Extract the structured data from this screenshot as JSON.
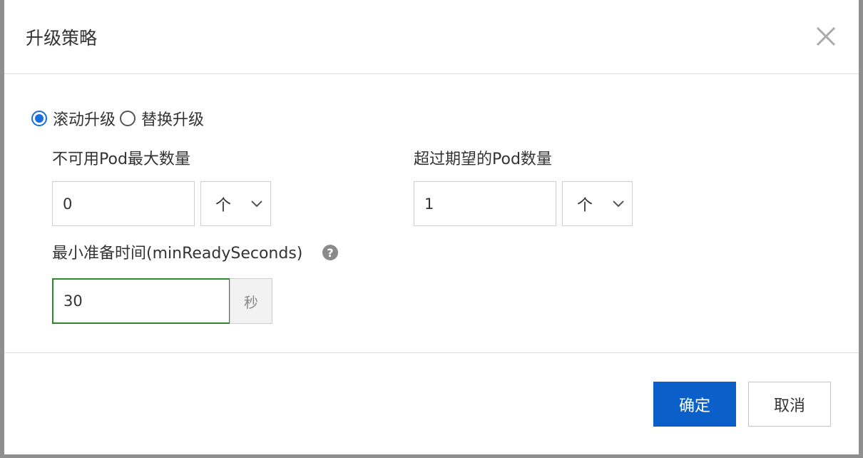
{
  "dialog": {
    "title": "升级策略",
    "close_icon": "close-icon"
  },
  "strategy": {
    "options": [
      {
        "label": "滚动升级",
        "checked": true
      },
      {
        "label": "替换升级",
        "checked": false
      }
    ]
  },
  "max_unavailable": {
    "label": "不可用Pod最大数量",
    "value": "0",
    "unit": "个"
  },
  "max_surge": {
    "label": "超过期望的Pod数量",
    "value": "1",
    "unit": "个"
  },
  "min_ready": {
    "label": "最小准备时间(minReadySeconds)",
    "value": "30",
    "unit": "秒",
    "help_icon": "question-circle-icon"
  },
  "footer": {
    "confirm_label": "确定",
    "cancel_label": "取消"
  },
  "colors": {
    "primary": "#0a5fc8",
    "radio_checked": "#1a6fe0",
    "focus_border": "#2a8a2a"
  }
}
